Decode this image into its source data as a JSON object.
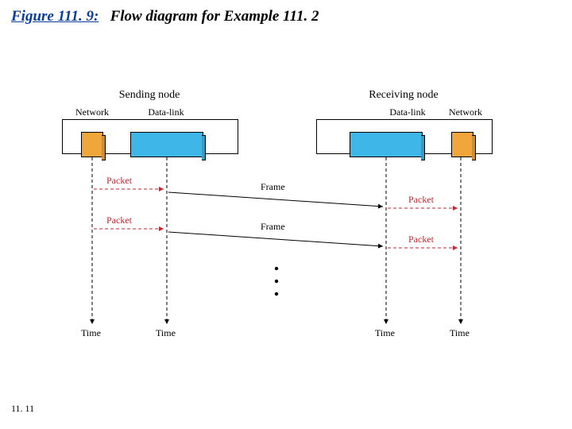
{
  "title": {
    "figure_prefix": "Figure 111. 9:",
    "caption": "Flow diagram for Example 111. 2"
  },
  "page_number": "11. 11",
  "nodes": {
    "sender": "Sending node",
    "receiver": "Receiving node"
  },
  "layers": {
    "network": "Network",
    "datalink": "Data-link"
  },
  "events": {
    "packet": "Packet",
    "frame": "Frame"
  },
  "axis": "Time",
  "colors": {
    "accent_link": "#0a3d9e",
    "orange": "#f1a63b",
    "blue": "#3fb6e8",
    "red": "#c1272d"
  }
}
